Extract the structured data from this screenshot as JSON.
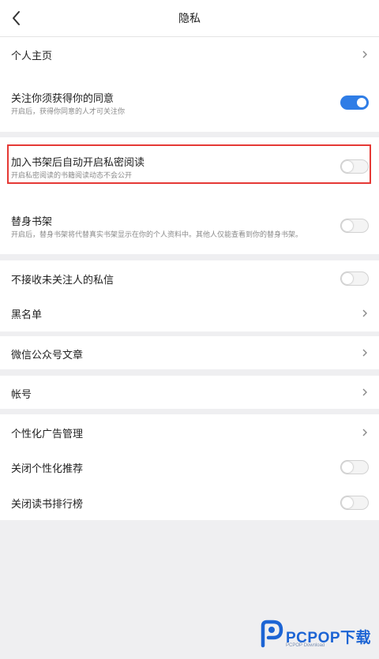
{
  "header": {
    "title": "隐私"
  },
  "items": {
    "profile": {
      "label": "个人主页"
    },
    "follow_consent": {
      "label": "关注你须获得你的同意",
      "desc": "开启后，获得你同意的人才可关注你",
      "enabled": true
    },
    "auto_private": {
      "label": "加入书架后自动开启私密阅读",
      "desc": "开启私密阅读的书籍阅读动态不会公开",
      "enabled": false
    },
    "proxy_shelf": {
      "label": "替身书架",
      "desc": "开启后，替身书架将代替真实书架显示在你的个人资料中。其他人仅能查看到你的替身书架。",
      "enabled": false
    },
    "no_stranger_msg": {
      "label": "不接收未关注人的私信",
      "enabled": false
    },
    "blacklist": {
      "label": "黑名单"
    },
    "wechat_articles": {
      "label": "微信公众号文章"
    },
    "account": {
      "label": "帐号"
    },
    "ad_management": {
      "label": "个性化广告管理"
    },
    "close_personal_rec": {
      "label": "关闭个性化推荐",
      "enabled": false
    },
    "close_ranking": {
      "label": "关闭读书排行榜",
      "enabled": false
    }
  },
  "watermark": {
    "text": "PCPOP下载",
    "sub": "PCPOP Download"
  },
  "colors": {
    "accent": "#2f7de6",
    "highlight": "#e53935",
    "background": "#efeff1"
  }
}
